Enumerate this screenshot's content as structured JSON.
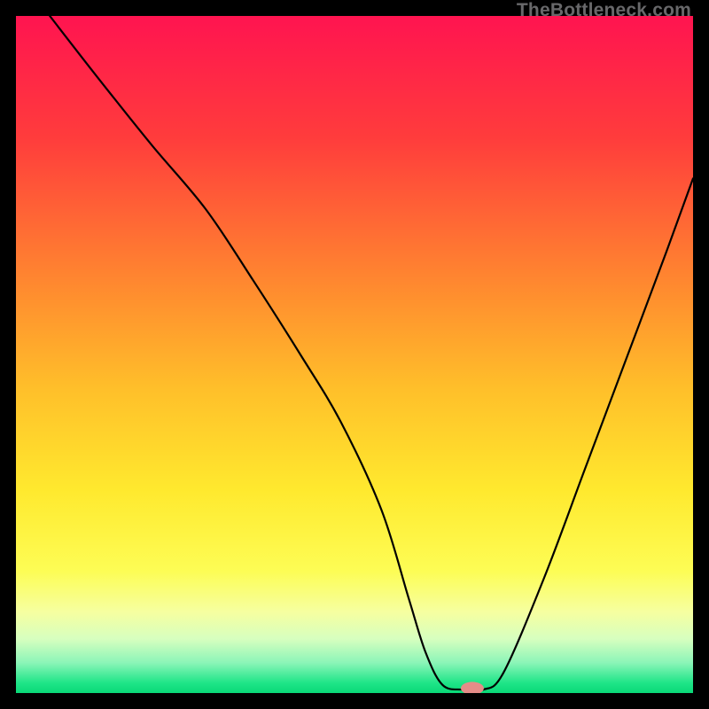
{
  "watermark": "TheBottleneck.com",
  "chart_data": {
    "type": "line",
    "title": "",
    "xlabel": "",
    "ylabel": "",
    "xlim": [
      0,
      100
    ],
    "ylim": [
      0,
      100
    ],
    "grid": false,
    "legend": false,
    "gradient_stops": [
      {
        "offset": 0,
        "color": "#ff1450"
      },
      {
        "offset": 0.18,
        "color": "#ff3c3c"
      },
      {
        "offset": 0.4,
        "color": "#ff8a2f"
      },
      {
        "offset": 0.55,
        "color": "#ffbf2a"
      },
      {
        "offset": 0.7,
        "color": "#ffe92e"
      },
      {
        "offset": 0.82,
        "color": "#fdfd55"
      },
      {
        "offset": 0.88,
        "color": "#f6ffa0"
      },
      {
        "offset": 0.92,
        "color": "#d7ffbf"
      },
      {
        "offset": 0.955,
        "color": "#8cf5b8"
      },
      {
        "offset": 0.985,
        "color": "#1fe588"
      },
      {
        "offset": 1.0,
        "color": "#09d877"
      }
    ],
    "curve": {
      "x": [
        5,
        12,
        20,
        28,
        35,
        42,
        48,
        54,
        58,
        60.5,
        63,
        66,
        69,
        72,
        78,
        84,
        90,
        96,
        100
      ],
      "y": [
        100,
        91,
        81,
        71.5,
        61,
        50,
        40,
        27,
        14,
        6,
        1.2,
        0.5,
        0.5,
        3,
        17,
        33,
        49,
        65,
        76
      ]
    },
    "marker": {
      "x": 67.4,
      "y": 0.7,
      "rx": 1.7,
      "ry": 0.95,
      "color": "#e58c88"
    }
  }
}
